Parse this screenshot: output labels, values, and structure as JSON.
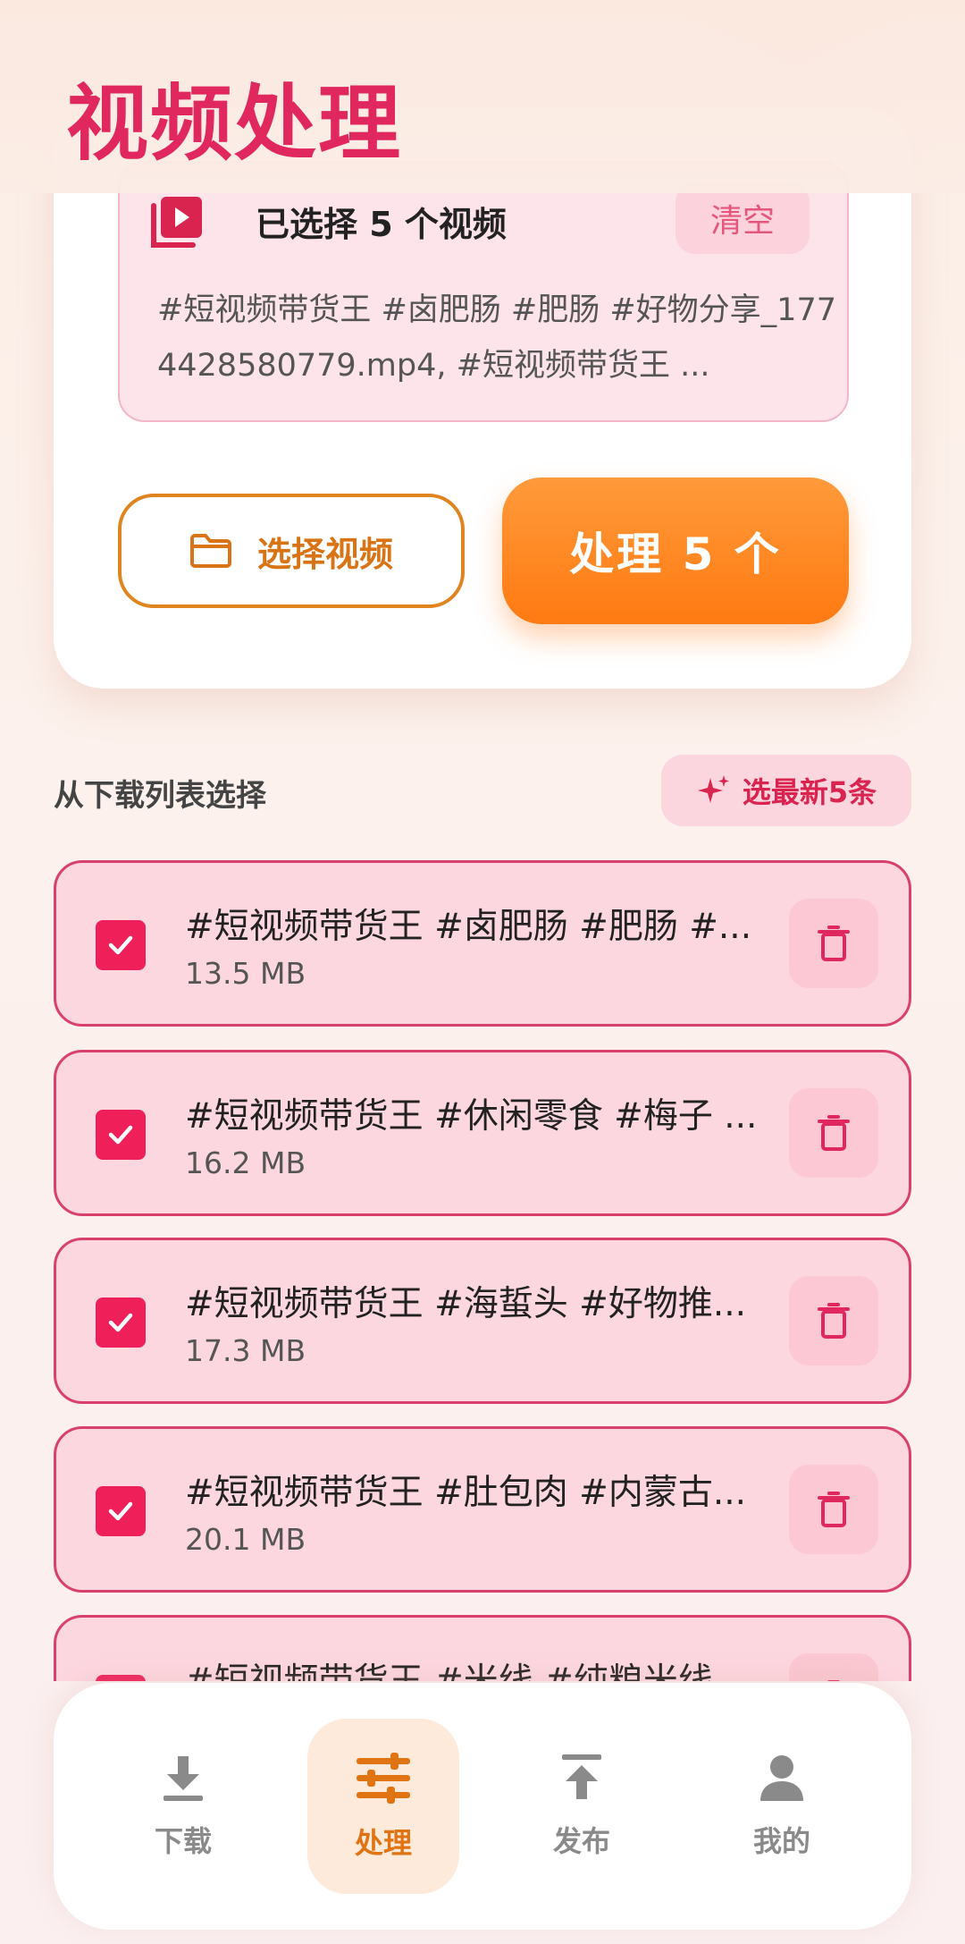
{
  "header": {
    "title": "视频处理"
  },
  "selection": {
    "title": "已选择 5 个视频",
    "clear_label": "清空",
    "files_preview": "#短视频带货王 #卤肥肠 #肥肠 #好物分享_1774428580779.mp4, #短视频带货王 ..."
  },
  "actions": {
    "choose_label": "选择视频",
    "process_label": "处理 5 个"
  },
  "section": {
    "label": "从下载列表选择",
    "latest_label": "选最新5条"
  },
  "list": {
    "items": [
      {
        "title": "#短视频带货王 #卤肥肠 #肥肠 #...",
        "size": "13.5 MB",
        "checked": true
      },
      {
        "title": "#短视频带货王 #休闲零食 #梅子 ...",
        "size": "16.2 MB",
        "checked": true
      },
      {
        "title": "#短视频带货王 #海蜇头 #好物推...",
        "size": "17.3 MB",
        "checked": true
      },
      {
        "title": "#短视频带货王 #肚包肉 #内蒙古...",
        "size": "20.1 MB",
        "checked": true
      },
      {
        "title": "#短视频带货王 #米线 #纯粮米线",
        "size": "",
        "checked": true
      }
    ]
  },
  "nav": {
    "items": [
      {
        "label": "下载",
        "icon": "download-icon",
        "active": false
      },
      {
        "label": "处理",
        "icon": "sliders-icon",
        "active": true
      },
      {
        "label": "发布",
        "icon": "upload-icon",
        "active": false
      },
      {
        "label": "我的",
        "icon": "person-icon",
        "active": false
      }
    ]
  },
  "colors": {
    "accent_pink": "#e0285f",
    "accent_orange": "#ff7a12",
    "item_bg": "#fdd7e0",
    "item_border": "#d9416d"
  }
}
